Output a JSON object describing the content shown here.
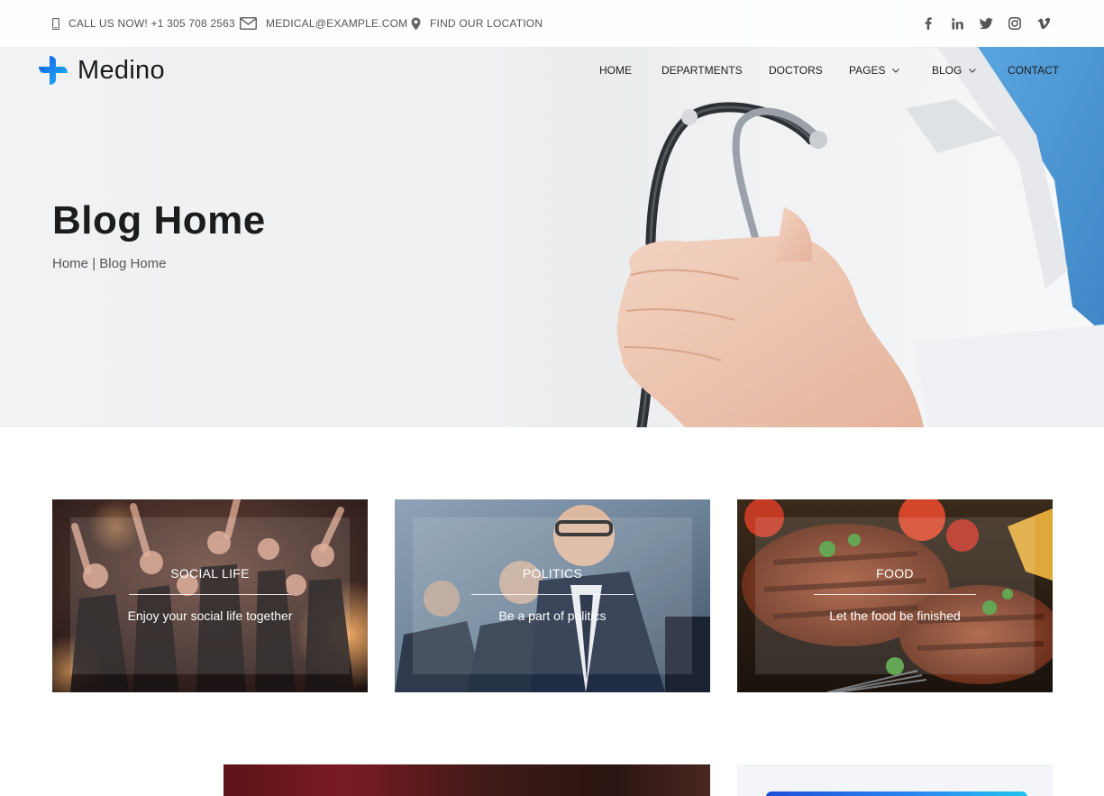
{
  "topbar": {
    "phone_label": "CALL US NOW! +1 305 708 2563",
    "email_label": "MEDICAL@EXAMPLE.COM",
    "location_label": "FIND OUR LOCATION",
    "social": [
      "facebook-icon",
      "linkedin-icon",
      "twitter-icon",
      "instagram-icon",
      "vimeo-icon"
    ]
  },
  "brand": {
    "name": "Medino",
    "accent": "#1e8fff"
  },
  "nav": {
    "items": [
      {
        "label": "HOME",
        "dropdown": false
      },
      {
        "label": "DEPARTMENTS",
        "dropdown": false
      },
      {
        "label": "DOCTORS",
        "dropdown": false
      },
      {
        "label": "PAGES",
        "dropdown": true
      },
      {
        "label": "BLOG",
        "dropdown": true
      },
      {
        "label": "CONTACT",
        "dropdown": false
      }
    ]
  },
  "hero": {
    "title": "Blog Home",
    "breadcrumb_home": "Home",
    "breadcrumb_separator": "|",
    "breadcrumb_current": "Blog Home"
  },
  "categories": [
    {
      "title": "SOCIAL LIFE",
      "text": "Enjoy your social life together"
    },
    {
      "title": "POLITICS",
      "text": "Be a part of politics"
    },
    {
      "title": "FOOD",
      "text": "Let the food be finished"
    }
  ]
}
